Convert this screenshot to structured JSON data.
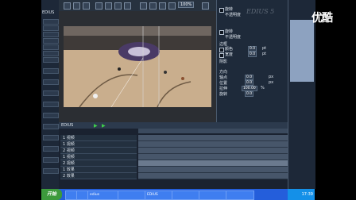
{
  "left_panel": {
    "title": "EDIUS"
  },
  "toolbar": {
    "zoom_value": "100%"
  },
  "settings": {
    "rows": [
      {
        "label": "旋转",
        "checked": false
      },
      {
        "label": "不透明度"
      },
      {
        "label": "旋转",
        "checked": false
      },
      {
        "label": "不透明度"
      },
      {
        "label": "边框"
      },
      {
        "label": "颜色",
        "value": "0.0",
        "unit": "pt"
      },
      {
        "label": "宽度",
        "value": "0.0",
        "unit": "pt"
      },
      {
        "label": "阴影"
      },
      {
        "label": "方向"
      },
      {
        "label": "轴点",
        "value": "0.0",
        "unit": "px"
      },
      {
        "label": "位置",
        "value": "0.0",
        "unit": "px"
      },
      {
        "label": "拉伸",
        "value": "100.00",
        "unit": "%"
      },
      {
        "label": "旋转",
        "value": "0.0"
      }
    ]
  },
  "watermark": {
    "main": "优酷",
    "sub": "EDIUS 5"
  },
  "timeline": {
    "title": "EDIUS",
    "tracks": [
      {
        "name": "1 视频"
      },
      {
        "name": "1 视频"
      },
      {
        "name": "2 视频"
      },
      {
        "name": "1 视频"
      },
      {
        "name": "2 视频"
      },
      {
        "name": "1 效果"
      },
      {
        "name": "2 效果"
      }
    ]
  },
  "taskbar": {
    "start_label": "开始",
    "tasks": [
      "",
      "",
      "edius",
      "",
      "EDIUS",
      "",
      "",
      ""
    ],
    "clock": "17:39"
  },
  "colors": {
    "taskbar": "#245edb",
    "panel": "#1e2a3a",
    "start": "#3c9a3c"
  }
}
